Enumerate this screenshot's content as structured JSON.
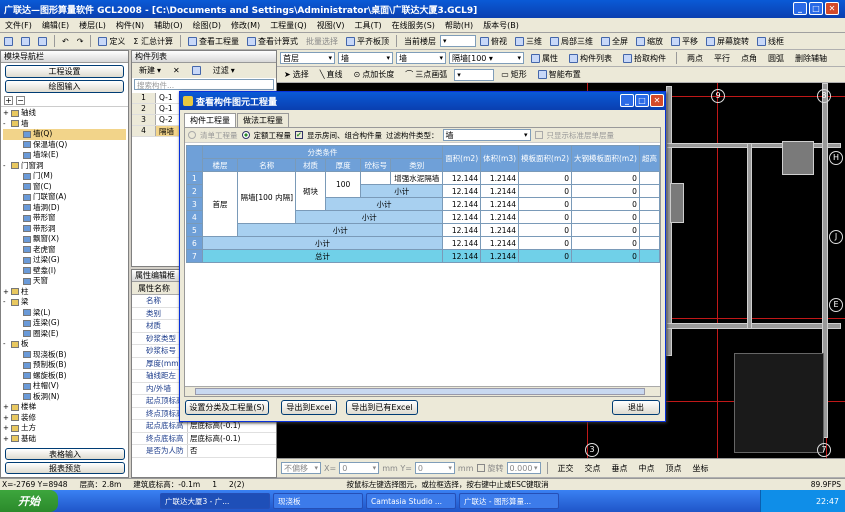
{
  "window": {
    "title": "广联达—图形算量软件 GCL2008 - [C:\\Documents and Settings\\Administrator\\桌面\\广联达大厦3.GCL9]"
  },
  "menu": [
    "文件(F)",
    "编辑(E)",
    "楼层(L)",
    "构件(N)",
    "辅助(O)",
    "绘图(D)",
    "修改(M)",
    "工程量(Q)",
    "视图(V)",
    "工具(T)",
    "在线服务(S)",
    "帮助(H)",
    "版本号(B)"
  ],
  "toolbar1": {
    "define": "定义",
    "sigma": "Σ 汇总计算",
    "view_qty": "查看工程量",
    "view_formula": "查看计算式",
    "batch_select": "批量选择",
    "flat_view": "平齐板顶",
    "floor_label": "当前楼层",
    "view_mode": "俯视",
    "three_d": "三维",
    "local_3d": "局部三维",
    "fullscreen": "全屏",
    "zoom": "缩放",
    "pan": "平移",
    "rotate": "屏幕旋转",
    "wireframe": "线框"
  },
  "toolbar2": {
    "floor": "首层",
    "type": "墙",
    "sub": "墙",
    "name": "隔墙[100 ▾",
    "props": "属性",
    "list": "构件列表",
    "pick": "拾取构件"
  },
  "toolbar3": {
    "select": "选择",
    "line": "直线",
    "point_len": "点加长度",
    "arc": "三点画弧",
    "rect": "矩形",
    "smart": "智能布置",
    "two_pt": "两点",
    "parallel": "平行",
    "angle": "点角",
    "circle": "圆弧",
    "del_aux": "删除辅轴"
  },
  "left_panel": {
    "title": "模块导航栏",
    "btn1": "工程设置",
    "btn2": "绘图输入",
    "tree": [
      {
        "label": "轴线",
        "indent": 0,
        "expand": "+"
      },
      {
        "label": "墙",
        "indent": 0,
        "expand": "-"
      },
      {
        "label": "墙(Q)",
        "indent": 2,
        "expand": ""
      },
      {
        "label": "保温墙(Q)",
        "indent": 2,
        "expand": ""
      },
      {
        "label": "墙垛(E)",
        "indent": 2,
        "expand": ""
      },
      {
        "label": "门窗洞",
        "indent": 0,
        "expand": "-"
      },
      {
        "label": "门(M)",
        "indent": 2,
        "expand": ""
      },
      {
        "label": "窗(C)",
        "indent": 2,
        "expand": ""
      },
      {
        "label": "门联窗(A)",
        "indent": 2,
        "expand": ""
      },
      {
        "label": "墙洞(D)",
        "indent": 2,
        "expand": ""
      },
      {
        "label": "带形窗",
        "indent": 2,
        "expand": ""
      },
      {
        "label": "带形洞",
        "indent": 2,
        "expand": ""
      },
      {
        "label": "飘窗(X)",
        "indent": 2,
        "expand": ""
      },
      {
        "label": "老虎窗",
        "indent": 2,
        "expand": ""
      },
      {
        "label": "过梁(G)",
        "indent": 2,
        "expand": ""
      },
      {
        "label": "壁龛(I)",
        "indent": 2,
        "expand": ""
      },
      {
        "label": "天窗",
        "indent": 2,
        "expand": ""
      },
      {
        "label": "柱",
        "indent": 0,
        "expand": "+"
      },
      {
        "label": "梁",
        "indent": 0,
        "expand": "-"
      },
      {
        "label": "梁(L)",
        "indent": 2,
        "expand": ""
      },
      {
        "label": "连梁(G)",
        "indent": 2,
        "expand": ""
      },
      {
        "label": "圈梁(E)",
        "indent": 2,
        "expand": ""
      },
      {
        "label": "板",
        "indent": 0,
        "expand": "-"
      },
      {
        "label": "现浇板(B)",
        "indent": 2,
        "expand": ""
      },
      {
        "label": "预制板(B)",
        "indent": 2,
        "expand": ""
      },
      {
        "label": "螺旋板(B)",
        "indent": 2,
        "expand": ""
      },
      {
        "label": "柱帽(V)",
        "indent": 2,
        "expand": ""
      },
      {
        "label": "板洞(N)",
        "indent": 2,
        "expand": ""
      },
      {
        "label": "楼梯",
        "indent": 0,
        "expand": "+"
      },
      {
        "label": "装修",
        "indent": 0,
        "expand": "+"
      },
      {
        "label": "土方",
        "indent": 0,
        "expand": "+"
      },
      {
        "label": "基础",
        "indent": 0,
        "expand": "+"
      }
    ],
    "bottom1": "表格输入",
    "bottom2": "报表预览"
  },
  "component_list": {
    "title": "构件列表",
    "new": "新建",
    "filter": "过滤",
    "search_placeholder": "搜索构件...",
    "rows": [
      {
        "n": "1",
        "name": "Q-1"
      },
      {
        "n": "2",
        "name": "Q-1"
      },
      {
        "n": "3",
        "name": "Q-2"
      },
      {
        "n": "4",
        "name": "隔墙"
      }
    ]
  },
  "props_panel": {
    "title": "属性编辑框",
    "header": "属性名称",
    "rows": [
      {
        "name": "名称",
        "val": ""
      },
      {
        "name": "类别",
        "val": ""
      },
      {
        "name": "材质",
        "val": ""
      },
      {
        "name": "砂浆类型",
        "val": ""
      },
      {
        "name": "砂浆标号",
        "val": ""
      },
      {
        "name": "厚度(mm)",
        "val": ""
      },
      {
        "name": "轴线距左",
        "val": ""
      },
      {
        "name": "内/外墙",
        "val": ""
      },
      {
        "name": "起点顶标高",
        "val": ""
      },
      {
        "name": "终点顶标高",
        "val": "层顶标高(2.7)"
      },
      {
        "name": "起点底标高",
        "val": "层底标高(-0.1)"
      },
      {
        "name": "终点底标高",
        "val": "层底标高(-0.1)"
      },
      {
        "name": "是否为人防",
        "val": "否"
      }
    ]
  },
  "canvas": {
    "axes": [
      "8",
      "H",
      "9",
      "J",
      "E",
      "3",
      "7"
    ]
  },
  "dialog": {
    "title": "查看构件图元工程量",
    "tabs": [
      "构件工程量",
      "做法工程量"
    ],
    "radio_list": "清单工程量",
    "radio_quota": "定额工程量",
    "chk_show": "显示房间、组合构件量",
    "filter_label": "过滤构件类型：",
    "filter_value": "墙",
    "chk_only": "只显示标准层单层量",
    "group_header": "分类条件",
    "col_heads": [
      "楼层",
      "名称",
      "材质",
      "厚度",
      "砼标号",
      "类别",
      "面积(m2)",
      "体积(m3)",
      "模板面积(m2)",
      "大钢模板面积(m2)",
      "超高"
    ],
    "rows": [
      {
        "n": "1",
        "cat": "增强水泥隔墙",
        "area": "12.144",
        "vol": "1.2144",
        "mold": "0",
        "steel": "0"
      },
      {
        "n": "2",
        "cat": "小计",
        "area": "12.144",
        "vol": "1.2144",
        "mold": "0",
        "steel": "0"
      },
      {
        "n": "3",
        "cat": "小计",
        "area": "12.144",
        "vol": "1.2144",
        "mold": "0",
        "steel": "0"
      },
      {
        "n": "4",
        "cat": "小计",
        "area": "12.144",
        "vol": "1.2144",
        "mold": "0",
        "steel": "0"
      },
      {
        "n": "5",
        "cat": "小计",
        "area": "12.144",
        "vol": "1.2144",
        "mold": "0",
        "steel": "0"
      },
      {
        "n": "6",
        "cat": "小计",
        "area": "12.144",
        "vol": "1.2144",
        "mold": "0",
        "steel": "0"
      },
      {
        "n": "7",
        "cat": "总计",
        "area": "12.144",
        "vol": "1.2144",
        "mold": "0",
        "steel": "0"
      }
    ],
    "floor": "首层",
    "name": "隔墙[100 内隔]",
    "material": "砌块",
    "thickness": "100",
    "btn_set": "设置分类及工程量(S)",
    "btn_excel": "导出到Excel",
    "btn_excel2": "导出到已有Excel",
    "btn_exit": "退出"
  },
  "bottom_tools": {
    "no_offset": "不偏移",
    "x_label": "X=",
    "x_val": "0",
    "y_label": "mm Y=",
    "y_val": "0",
    "mm": "mm",
    "rotate": "旋转",
    "rot_val": "0.000",
    "orth": "正交",
    "inter": "交点",
    "perp": "垂点",
    "mid": "中点",
    "top": "顶点",
    "coord": "坐标"
  },
  "status": {
    "xy": "X=-2769 Y=8948",
    "floor_h": "层高：2.8m",
    "elev": "建筑底标高：-0.1m",
    "count": "1",
    "sel": "2(2)",
    "hint": "按鼠标左键选择图元，或拉框选择，按右键中止或ESC键取消",
    "fps": "89.9FPS"
  },
  "taskbar": {
    "start": "开始",
    "tasks": [
      "广联达大厦3 - 广...",
      "现浇板",
      "Camtasia Studio ...",
      "广联达 - 图形算量..."
    ],
    "clock": "22:47"
  }
}
